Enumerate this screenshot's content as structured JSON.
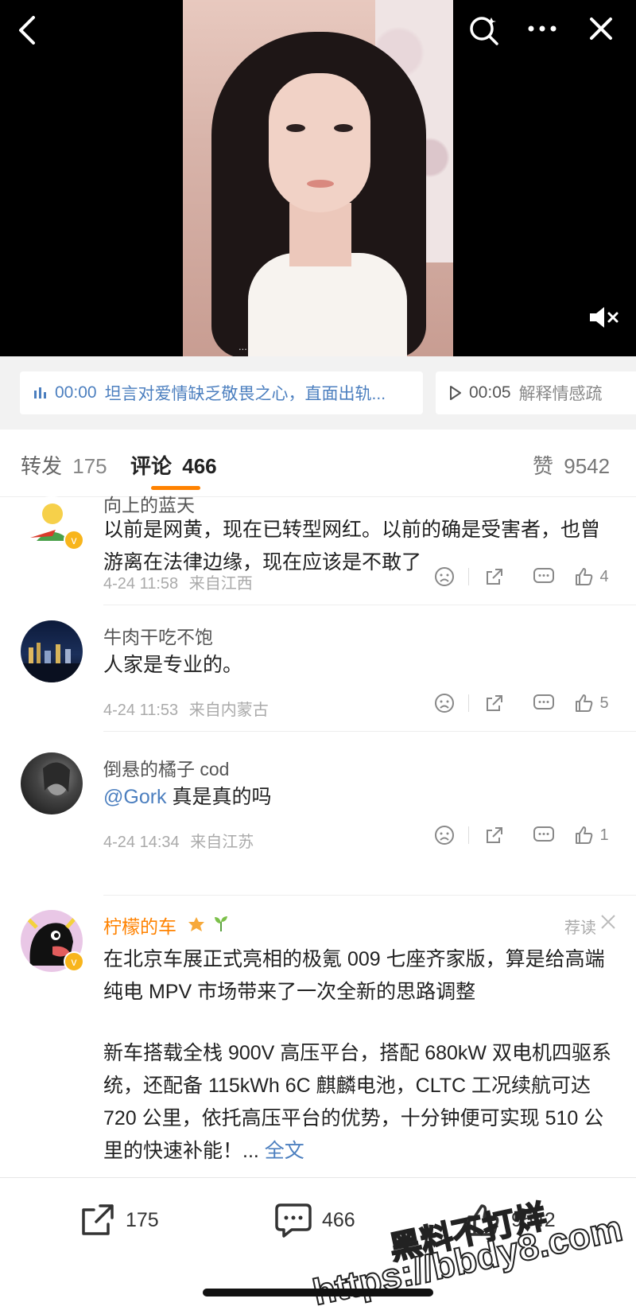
{
  "video": {
    "subtitle_partial": "...",
    "chips": [
      {
        "time": "00:00",
        "text": "坦言对爱情缺乏敬畏之心，直面出轨..."
      },
      {
        "time": "00:05",
        "text": "解释情感疏"
      }
    ]
  },
  "tabs": {
    "repost_label": "转发",
    "repost_count": "175",
    "comment_label": "评论",
    "comment_count": "466",
    "like_label": "赞",
    "like_count": "9542"
  },
  "comments": [
    {
      "name": "向上的蓝天",
      "text": "以前是网黄，现在已转型网红。以前的确是受害者，也曾游离在法律边缘，现在应该是不敢了",
      "time": "4-24 11:58",
      "location": "来自江西",
      "likes": "4"
    },
    {
      "name": "牛肉干吃不饱",
      "text": "人家是专业的。",
      "time": "4-24 11:53",
      "location": "来自内蒙古",
      "likes": "5"
    },
    {
      "name": "倒悬的橘子 cod",
      "mention": "@Gork",
      "text": " 真是真的吗",
      "time": "4-24 14:34",
      "location": "来自江苏",
      "likes": "1"
    }
  ],
  "promoted": {
    "name": "柠檬的车",
    "tag": "荐读",
    "para1": "在北京车展正式亮相的极氪 009 七座齐家版，算是给高端纯电 MPV 市场带来了一次全新的思路调整",
    "para2": "新车搭载全栈 900V 高压平台，搭配 680kW 双电机四驱系统，还配备 115kWh 6C 麒麟电池，CLTC 工况续航可达 720 公里，依托高压平台的优势，十分钟便可实现 510 公里的快速补能！...",
    "more": "全文"
  },
  "bottom": {
    "repost": "175",
    "comment": "466",
    "like": "9542"
  },
  "watermark": {
    "line1": "黑料不打烊",
    "line2": "https://bbdy8.com"
  },
  "colors": {
    "accent": "#ff8200",
    "link": "#4c7fbf",
    "vip_badge": "#f8b51c"
  }
}
